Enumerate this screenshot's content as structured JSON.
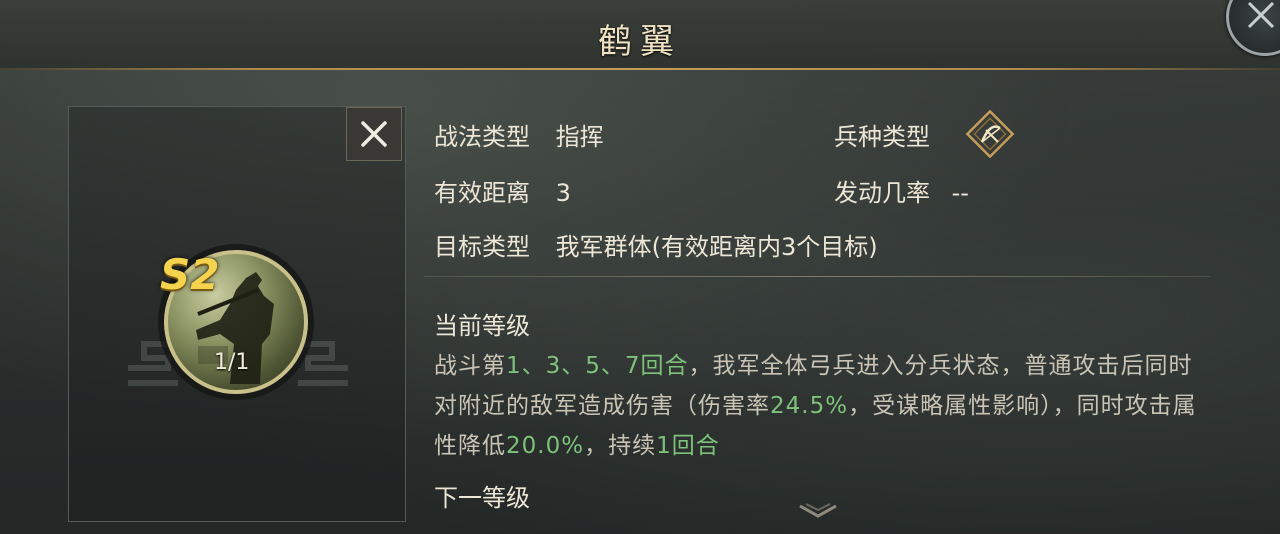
{
  "header": {
    "title": "鹤翼"
  },
  "skill": {
    "grade": "S2",
    "level_count": "1/1"
  },
  "info": {
    "tactic_type_label": "战法类型",
    "tactic_type_value": "指挥",
    "troop_type_label": "兵种类型",
    "troop_type_icon": "crossbow-icon",
    "range_label": "有效距离",
    "range_value": "3",
    "trigger_label": "发动几率",
    "trigger_value": "--",
    "target_label": "目标类型",
    "target_value": "我军群体(有效距离内3个目标)"
  },
  "current_level": {
    "title": "当前等级",
    "desc_parts": [
      {
        "text": "战斗第",
        "hl": false
      },
      {
        "text": "1、3、5、7回合",
        "hl": true
      },
      {
        "text": "，我军全体弓兵进入分兵状态，普通攻击后同时对附近的敌军造成伤害（伤害率",
        "hl": false
      },
      {
        "text": "24.5%",
        "hl": true
      },
      {
        "text": "，受谋略属性影响），同时攻击属性降低",
        "hl": false
      },
      {
        "text": "20.0%",
        "hl": true
      },
      {
        "text": "，持续",
        "hl": false
      },
      {
        "text": "1回合",
        "hl": true
      }
    ]
  },
  "next_level": {
    "title": "下一等级"
  },
  "colors": {
    "accent_gold": "#c59c5a",
    "highlight_green": "#7ec27a"
  }
}
